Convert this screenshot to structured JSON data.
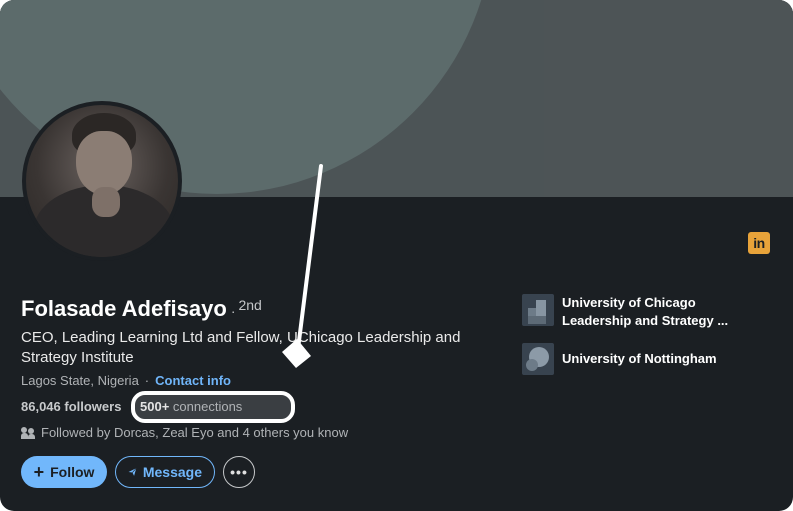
{
  "profile": {
    "name": "Folasade Adefisayo",
    "degree_separator": "·",
    "degree": "2nd",
    "headline": "CEO, Leading Learning Ltd and Fellow, UChicago Leadership and Strategy Institute",
    "location": "Lagos State, Nigeria",
    "location_separator": "·",
    "contact_info_label": "Contact info",
    "followers": "86,046 followers",
    "connections_count": "500+",
    "connections_label": "connections",
    "followed_by": "Followed by Dorcas, Zeal Eyo and 4 others you know"
  },
  "actions": {
    "follow_label": "Follow",
    "follow_icon": "+",
    "message_label": "Message",
    "more_label": "•••"
  },
  "education": [
    {
      "name": "University of Chicago Leadership and Strategy ..."
    },
    {
      "name": "University of Nottingham"
    }
  ],
  "badge": {
    "label": "in",
    "color": "#e8a33a"
  },
  "colors": {
    "card_background": "#1b1f23",
    "banner": "#5c6b6b",
    "accent_blue": "#71b7fb",
    "annotation": "#ffffff"
  }
}
